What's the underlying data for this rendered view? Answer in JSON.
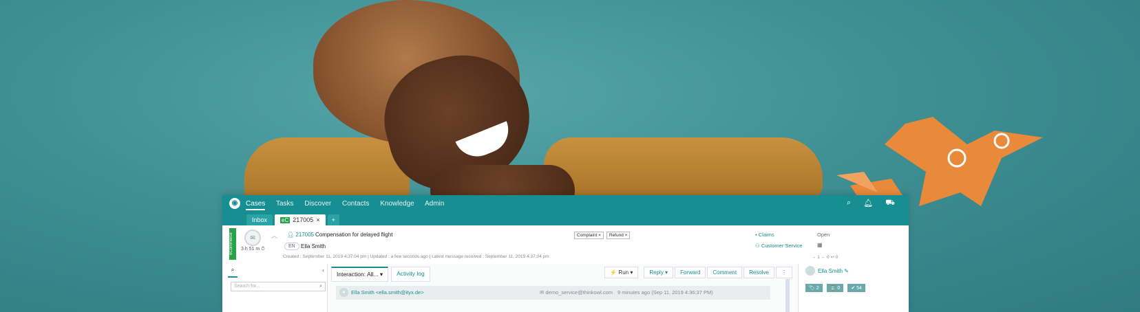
{
  "topnav": {
    "items": [
      "Cases",
      "Tasks",
      "Discover",
      "Contacts",
      "Knowledge",
      "Admin"
    ],
    "active": "Cases"
  },
  "tabs": {
    "inbox": "Inbox",
    "case_badge": "eC",
    "case_tab": "217005",
    "add": "+"
  },
  "case": {
    "channel_label": "eCommerce",
    "time_left": "3 h 51 m",
    "id": "217005",
    "title": "Compensation for delayed flight",
    "language": "EN",
    "contact": "Ella Smith",
    "tags": [
      "Complaint",
      "Refund"
    ],
    "queue_1": "Claims",
    "queue_2": "Customer Service",
    "status": "Open",
    "created": "Created : September 11, 2019 4:37:04 pm",
    "updated": "Updated : a few seconds ago",
    "latest": "Latest message received : September 11, 2019 4:37:04 pm",
    "counts": "→ 1   ← 0   ↩ 0"
  },
  "left": {
    "search_placeholder": "Search for..."
  },
  "middle": {
    "tab_interaction": "Interaction: All...",
    "tab_activity": "Activity log",
    "run": "Run",
    "reply": "Reply",
    "forward": "Forward",
    "comment": "Comment",
    "resolve": "Resolve",
    "message_from": "Ella Smith <ella.smith@ityx.de>",
    "message_to": "demo_service@thinkowl.com",
    "message_time": "9 minutes ago (Sep 11, 2019 4:36:37 PM)"
  },
  "right": {
    "contact_name": "Ella Smith",
    "badge_tags": "2",
    "badge_pending": "0",
    "badge_done": "54"
  },
  "colors": {
    "brand": "#178e92",
    "ecommerce": "#27a44a",
    "bird": "#e98a3b"
  }
}
